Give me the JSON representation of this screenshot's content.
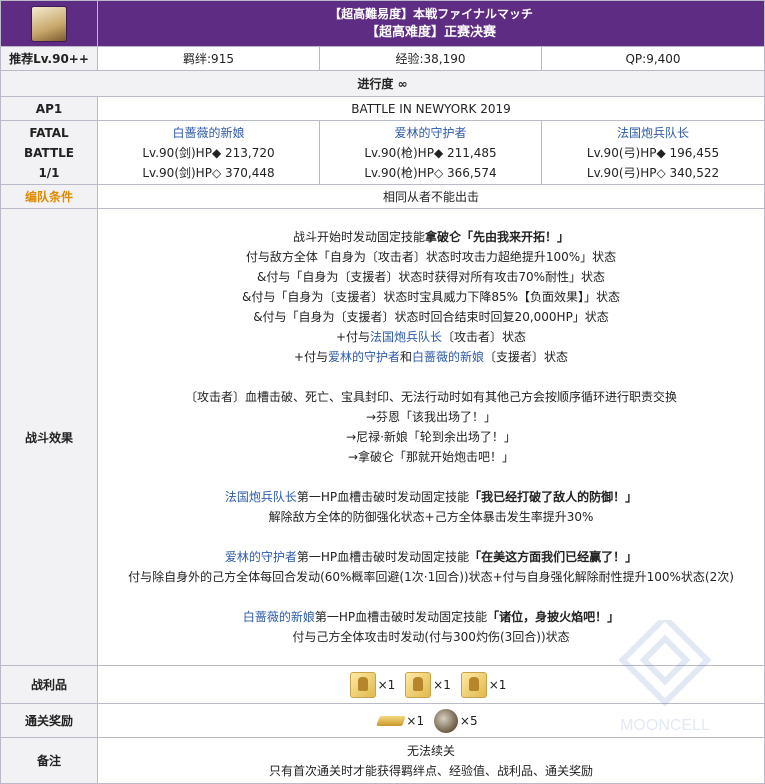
{
  "header": {
    "title_jp": "【超高難易度】本戦ファイナルマッチ",
    "title_cn": "【超高难度】正赛决赛",
    "avatar_alt": "quest-avatar"
  },
  "stats": {
    "level": "推荐Lv.90++",
    "bond": "羁绊:915",
    "exp": "经验:38,190",
    "qp": "QP:9,400"
  },
  "progress_label": "进行度 ∞",
  "ap_label": "AP1",
  "battle_name": "BATTLE IN NEWYORK 2019",
  "battle_label_1": "FATAL",
  "battle_label_2": "BATTLE",
  "battle_label_3": "1/1",
  "enemies": [
    {
      "name": "白蔷薇的新娘",
      "line1": "Lv.90(剑)HP◆ 213,720",
      "line2": "Lv.90(剑)HP◇ 370,448"
    },
    {
      "name": "爱林的守护者",
      "line1": "Lv.90(枪)HP◆ 211,485",
      "line2": "Lv.90(枪)HP◇ 366,574"
    },
    {
      "name": "法国炮兵队长",
      "line1": "Lv.90(弓)HP◆ 196,455",
      "line2": "Lv.90(弓)HP◇ 340,522"
    }
  ],
  "team_condition_label": "编队条件",
  "team_condition": "相同从者不能出击",
  "effects_label": "战斗效果",
  "effects": [
    "战斗开始时发动固定技能拿破仑「先由我来开拓！」",
    "付与敌方全体「自身为〔攻击者〕状态时攻击力超绝提升100%」状态",
    "&付与「自身为〔支援者〕状态时获得对所有攻击70%耐性」状态",
    "&付与「自身为〔支援者〕状态时宝具威力下降85%【负面效果】」状态",
    "&付与「自身为〔支援者〕状态时回合结束时回复20,000HP」状态",
    "+付与法国炮兵队长〔攻击者〕状态",
    "+付与爱林的守护者和白蔷薇的新娘〔支援者〕状态",
    "",
    "〔攻击者〕血槽击破、死亡、宝具封印、无法行动时如有其他己方会按顺序循环进行职责交换",
    "→芬恩「该我出场了！」",
    "→尼禄·新娘「轮到余出场了！」",
    "→拿破仑「那就开始炮击吧！」",
    "",
    "法国炮兵队长第一HP血槽击破时发动固定技能「我已经打破了敌人的防御！」",
    "解除敌方全体的防御强化状态+己方全体暴击发生率提升30%",
    "",
    "爱林的守护者第一HP血槽击破时发动固定技能「在美这方面我们已经赢了！」",
    "付与除自身外的己方全体每回合发动(60%概率回避(1次·1回合))状态+付与自身强化解除耐性提升100%状态(2次)",
    "",
    "白蔷薇的新娘第一HP血槽击破时发动固定技能「诸位，身披火焰吧！」",
    "付与己方全体攻击时发动(付与300灼伤(3回合))状态"
  ],
  "drops_label": "战利品",
  "drops": [
    {
      "qty": "×1"
    },
    {
      "qty": "×1"
    },
    {
      "qty": "×1"
    }
  ],
  "rewards_label": "通关奖励",
  "rewards": [
    {
      "qty": "×1"
    },
    {
      "qty": "×5"
    }
  ],
  "notes_label": "备注",
  "notes": [
    "无法续关",
    "只有首次通关时才能获得羁绊点、经验值、战利品、通关奖励"
  ],
  "watermark": "MOONCELL",
  "colors": {
    "accent": "#5e2c82",
    "link": "#2d5aa8",
    "label_orange": "#e08a00"
  }
}
